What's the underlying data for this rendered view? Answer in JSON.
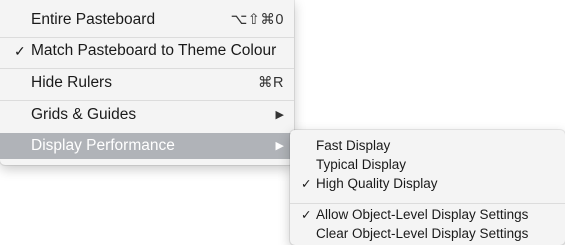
{
  "main_menu": {
    "items": [
      {
        "label": "Entire Pasteboard",
        "shortcut": "⌥⇧⌘0",
        "checked": false
      },
      {
        "label": "Match Pasteboard to Theme Colour",
        "shortcut": "",
        "checked": true,
        "check_glyph": "✓"
      },
      {
        "label": "Hide Rulers",
        "shortcut": "⌘R",
        "checked": false
      },
      {
        "label": "Grids & Guides",
        "submenu_arrow": "▶",
        "checked": false
      },
      {
        "label": "Display Performance",
        "submenu_arrow": "▶",
        "checked": false,
        "highlighted": true
      }
    ]
  },
  "display_performance_submenu": {
    "items": [
      {
        "label": "Fast Display",
        "checked": false
      },
      {
        "label": "Typical Display",
        "checked": false
      },
      {
        "label": "High Quality Display",
        "checked": true,
        "check_glyph": "✓"
      },
      {
        "label": "Allow Object-Level Display Settings",
        "checked": true,
        "check_glyph": "✓"
      },
      {
        "label": "Clear Object-Level Display Settings",
        "checked": false
      }
    ]
  },
  "colors": {
    "menu_background": "#f4f4f4",
    "highlight": "#b0b3b8"
  }
}
